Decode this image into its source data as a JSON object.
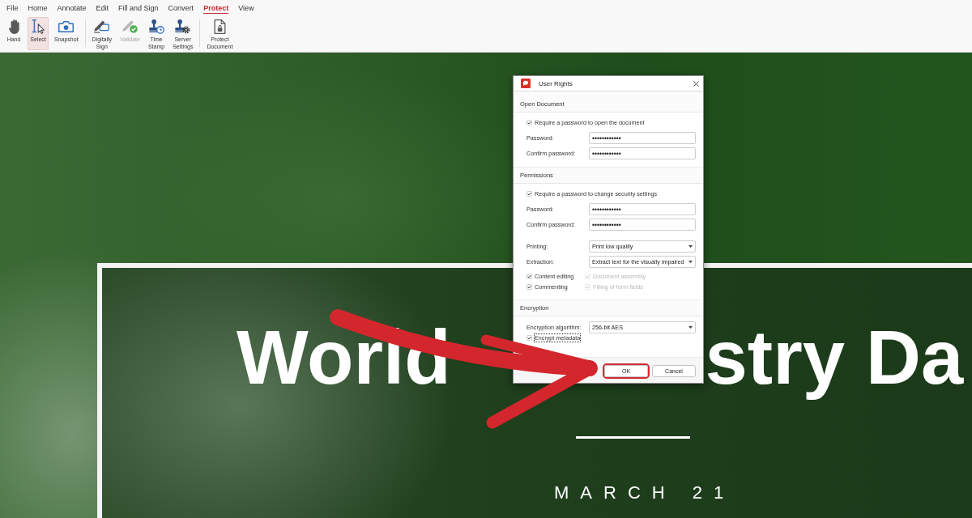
{
  "ribbon": {
    "tabs": [
      {
        "label": "File",
        "selected": false
      },
      {
        "label": "Home",
        "selected": false
      },
      {
        "label": "Annotate",
        "selected": false
      },
      {
        "label": "Edit",
        "selected": false
      },
      {
        "label": "Fill and Sign",
        "selected": false
      },
      {
        "label": "Convert",
        "selected": false
      },
      {
        "label": "Protect",
        "selected": true
      },
      {
        "label": "View",
        "selected": false
      }
    ],
    "tool_groups": [
      [
        {
          "label": "Hand",
          "selected": false,
          "disabled": false
        },
        {
          "label": "Select",
          "selected": true,
          "disabled": false
        },
        {
          "label": "Snapshot",
          "selected": false,
          "disabled": false
        }
      ],
      [
        {
          "label": "Digitally Sign",
          "selected": false,
          "disabled": false
        },
        {
          "label": "Validate",
          "selected": false,
          "disabled": true
        },
        {
          "label": "Time Stamp",
          "selected": false,
          "disabled": false
        },
        {
          "label": "Server Settings",
          "selected": false,
          "disabled": false
        }
      ],
      [
        {
          "label": "Protect Document",
          "selected": false,
          "disabled": false
        }
      ]
    ]
  },
  "document": {
    "heading": [
      "World",
      "stry Da"
    ],
    "date": "MARCH 21"
  },
  "dialog": {
    "title": "User Rights",
    "sections": [
      {
        "heading": "Open Document",
        "rows": [
          {
            "kind": "checkbox",
            "label": "Require a password to open the document",
            "checked": true,
            "focused": false
          },
          {
            "kind": "password",
            "label": "Password:",
            "value": "••••••••••••"
          },
          {
            "kind": "password",
            "label": "Confirm password:",
            "value": "••••••••••••"
          }
        ]
      },
      {
        "heading": "Permissions",
        "rows": [
          {
            "kind": "checkbox",
            "label": "Require a password to change security settings",
            "checked": true,
            "focused": false
          },
          {
            "kind": "password",
            "label": "Password:",
            "value": "••••••••••••"
          },
          {
            "kind": "password",
            "label": "Confirm password:",
            "value": "••••••••••••"
          },
          {
            "kind": "dropdown",
            "label": "Printing:",
            "value": "Print low quality"
          },
          {
            "kind": "dropdown",
            "label": "Extraction:",
            "value": "Extract text for the visually impaired"
          },
          {
            "kind": "options",
            "items": [
              {
                "label": "Content editing",
                "checked": true,
                "disabled": false
              },
              {
                "label": "Document assembly",
                "checked": true,
                "disabled": true
              },
              {
                "label": "Commenting",
                "checked": true,
                "disabled": false
              },
              {
                "label": "Filling of form fields",
                "checked": true,
                "disabled": true
              }
            ]
          }
        ]
      },
      {
        "heading": "Encryption",
        "rows": [
          {
            "kind": "dropdown",
            "label": "Encryption algorithm:",
            "value": "256-bit AES"
          },
          {
            "kind": "checkbox",
            "label": "Encrypt metadata",
            "checked": true,
            "focused": true
          }
        ]
      }
    ],
    "buttons": [
      {
        "label": "OK",
        "highlighted": true
      },
      {
        "label": "Cancel",
        "highlighted": false
      }
    ]
  }
}
